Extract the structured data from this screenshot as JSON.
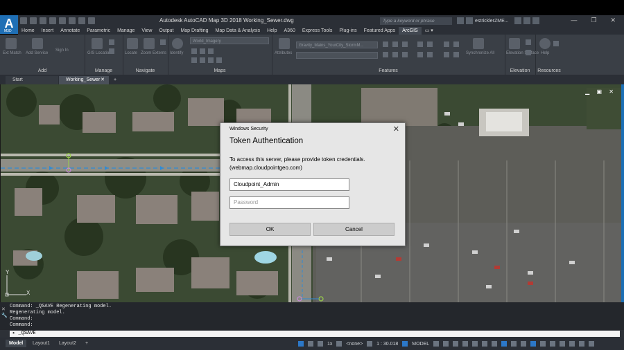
{
  "app": {
    "logo_letter": "A",
    "logo_sub": "M3D",
    "title": "Autodesk AutoCAD Map 3D 2018   Working_Sewer.dwg",
    "search_placeholder": "Type a keyword or phrase",
    "user": "estricklerZME...",
    "window_controls": [
      "—",
      "❐",
      "✕"
    ]
  },
  "menu_tabs": [
    "Home",
    "Insert",
    "Annotate",
    "Parametric",
    "Manage",
    "View",
    "Output",
    "Map Drafting",
    "Map Data & Analysis",
    "Help",
    "A360",
    "Express Tools",
    "Plug-ins",
    "Featured Apps",
    "ArcGIS"
  ],
  "active_menu_tab": "ArcGIS",
  "ribbon": {
    "panels": [
      {
        "title": "Add",
        "items": [
          "Ext Match",
          "Add Service",
          "Sign In"
        ]
      },
      {
        "title": "Manage",
        "items": [
          "GIS Location"
        ]
      },
      {
        "title": "Navigate",
        "items": [
          "Locate",
          "Zoom Extents"
        ]
      },
      {
        "title": "Maps",
        "items": [
          "Identify"
        ],
        "dropdown": "World_Imagery"
      },
      {
        "title": "Features",
        "items": [
          "Attributes"
        ],
        "dropdown": "Gravity_Mains_YourCity_StormM..."
      },
      {
        "title": "Elevation",
        "items": [
          "Synchronize All",
          "Elevation Surface"
        ]
      },
      {
        "title": "Resources",
        "items": [
          "Help"
        ]
      }
    ]
  },
  "doc_tabs": {
    "start": "Start",
    "active": "Working_Sewer",
    "active_close": "✕",
    "add": "+"
  },
  "viewport_controls": "▁ ▣ ✕",
  "ucs": {
    "y": "Y",
    "x": "X"
  },
  "dialog": {
    "window_title": "Windows Security",
    "close": "✕",
    "heading": "Token Authentication",
    "message_line1": "To access this server, please provide token credentials.",
    "message_line2": "(webmap.cloudpointgeo.com)",
    "username_value": "Cloudpoint_Admin",
    "password_placeholder": "Password",
    "ok_label": "OK",
    "cancel_label": "Cancel"
  },
  "command_history": [
    "Command: _QSAVE Regenerating model.",
    "Regenerating model.",
    "Command:",
    "Command:"
  ],
  "command_input": "▸ _QSAVE",
  "layout_tabs": [
    "Model",
    "Layout1",
    "Layout2",
    "+"
  ],
  "status": {
    "x_label": "1x",
    "none_label": "<none>",
    "scale": "1 : 30.018",
    "space": "MODEL"
  },
  "colors": {
    "accent_blue": "#1f6fb5",
    "ribbon_bg": "#3a3f46",
    "dialog_bg": "#e6e6e6",
    "sewer_line": "#2f8bd6",
    "node_green": "#9bd24a"
  }
}
